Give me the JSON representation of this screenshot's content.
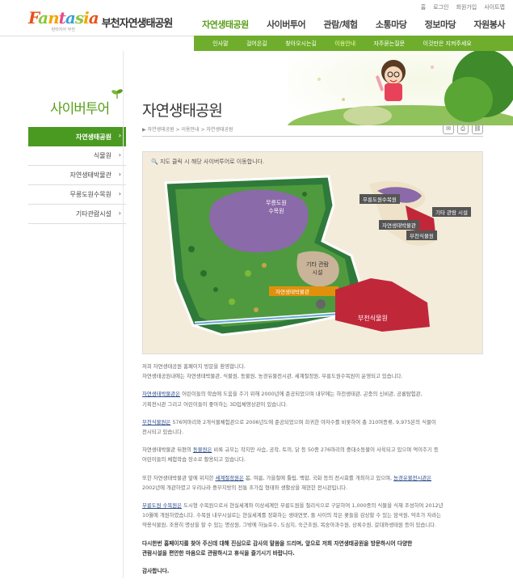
{
  "util_links": [
    "홈",
    "로그인",
    "회원가입",
    "사이트맵"
  ],
  "logo": {
    "en": "Fantasia",
    "sub": "판타지아 부천",
    "ko": "부천자연생태공원"
  },
  "gnb": [
    {
      "label": "자연생태공원",
      "active": true
    },
    {
      "label": "사이버투어",
      "active": false
    },
    {
      "label": "관람/체험",
      "active": false
    },
    {
      "label": "소통마당",
      "active": false
    },
    {
      "label": "정보마당",
      "active": false
    },
    {
      "label": "자원봉사",
      "active": false
    }
  ],
  "subnav": [
    {
      "label": "인사말",
      "active": false
    },
    {
      "label": "걸어온길",
      "active": false
    },
    {
      "label": "찾아오시는길",
      "active": false
    },
    {
      "label": "이용안내",
      "active": true
    },
    {
      "label": "자주묻는질문",
      "active": false
    },
    {
      "label": "이것만은 지켜주세요",
      "active": false
    }
  ],
  "sidebar": {
    "title": "사이버투어",
    "items": [
      {
        "label": "자연생태공원",
        "active": true
      },
      {
        "label": "식물원",
        "active": false
      },
      {
        "label": "자연생태박물관",
        "active": false
      },
      {
        "label": "무릉도원수목원",
        "active": false
      },
      {
        "label": "기타관람시설",
        "active": false
      }
    ]
  },
  "page": {
    "title": "자연생태공원",
    "breadcrumb": "▶ 자연생태공원 > 이용안내 > 자연생태공원"
  },
  "map": {
    "hint": "지도 클릭 시 해당 사이버투어로 이동합니다.",
    "labels": {
      "mureung": "무릉도원\n수목원",
      "etc": "기타 관람\n시설",
      "museum": "자연생태박물관",
      "botanic": "부천식물원",
      "legend_mureung": "무릉도원수목원",
      "legend_etc": "기타 관람 시설",
      "legend_museum": "자연생태박물관",
      "legend_botanic": "부천식물원"
    },
    "colors": {
      "mureung": "#8a6aa8",
      "etc": "#c9b49a",
      "museum": "#e0900a",
      "botanic": "#c0283a",
      "park": "#4e9a3a"
    }
  },
  "body": {
    "p1a": "저희 자연생태공원 홈페이지 방문을 환영합니다.",
    "p1b": "자연생태공원내에는 자연생태박물관, 식물원, 동물원, 농경유물전시관, 세계절정원, 무릉도원수목원이 운영되고 있습니다.",
    "p2_link": "자연생태박물관은",
    "p2": " 어린이들의 학습에 도움을 주기 위해 2000년에 준공되었으며 내부에는 하천생태관, 곤충의 신비관, 공룡탐험관,",
    "p2b": "기획전시관 그리고 어린이들이 좋아하는 3D입체영상관이 있습니다.",
    "p3_link": "부천식물원은",
    "p3": " 576여마리와 2개식물체험관으로 2006년도에 준공되었으며 희귀한 야자수를 비롯하여 총 310여종류, 9,975본의 식물이",
    "p3b": "전시되고 있습니다.",
    "p4a": "자연생태박물관 뒤편의 ",
    "p4_link": "동물원은",
    "p4": " 비록 규모는 작지만 사슴, 공작, 토끼, 닭 등 50종 276마리의 중대소동물이 사육되고 있으며 먹이주기 등",
    "p4b": "어린이들의 체험학습 장소로 활용되고 있습니다.",
    "p5a": "또한 자연생태박물관 앞에 위치한 ",
    "p5_link1": "세계절정원은",
    "p5": " 봄, 여름, 가을철에 튤립, 백합, 국화 등의 전시회를 개최하고 있으며, ",
    "p5_link2": "농경유물전시관은",
    "p5b": "2002년에 개관하였고 우리나라 중부지방의 전통 초가집 형태와 생활상을 재현한 전시관입니다.",
    "p6_link": "무릉도원 수목원은",
    "p6": " 도시형 수목원으로서 현실세계와 이상세계인 무릉도원을 절리식으로 구분하여 1,000종의 식물을 식재 조성하여 2012년",
    "p6b": "10월에 개원하였습니다. 수목원 내부시설로는 현실세계를 정화하는 생태연못, 돌 사이의 작은 꽃들을 감상할 수 있는 암석원, 약초가 자라는",
    "p6c": "약용식물원, 조용히 명상을 할 수 있는 명상원, 그밖에 하늘호수, 도심지, 숙근초원, 복숭아과수원, 상록수원, 갈대와생태원 등이 있습니다.",
    "closing1": "다시한번 홈페이지를 찾아 주신데 대해 진심으로 감사의 말씀을 드리며, 앞으로 저희 자연생태공원을 방문하시어 다양한",
    "closing2": "관람시설을 편안한 마음으로 관람하시고 휴식을 즐기시기 바랍니다.",
    "thanks": "감사합니다."
  }
}
